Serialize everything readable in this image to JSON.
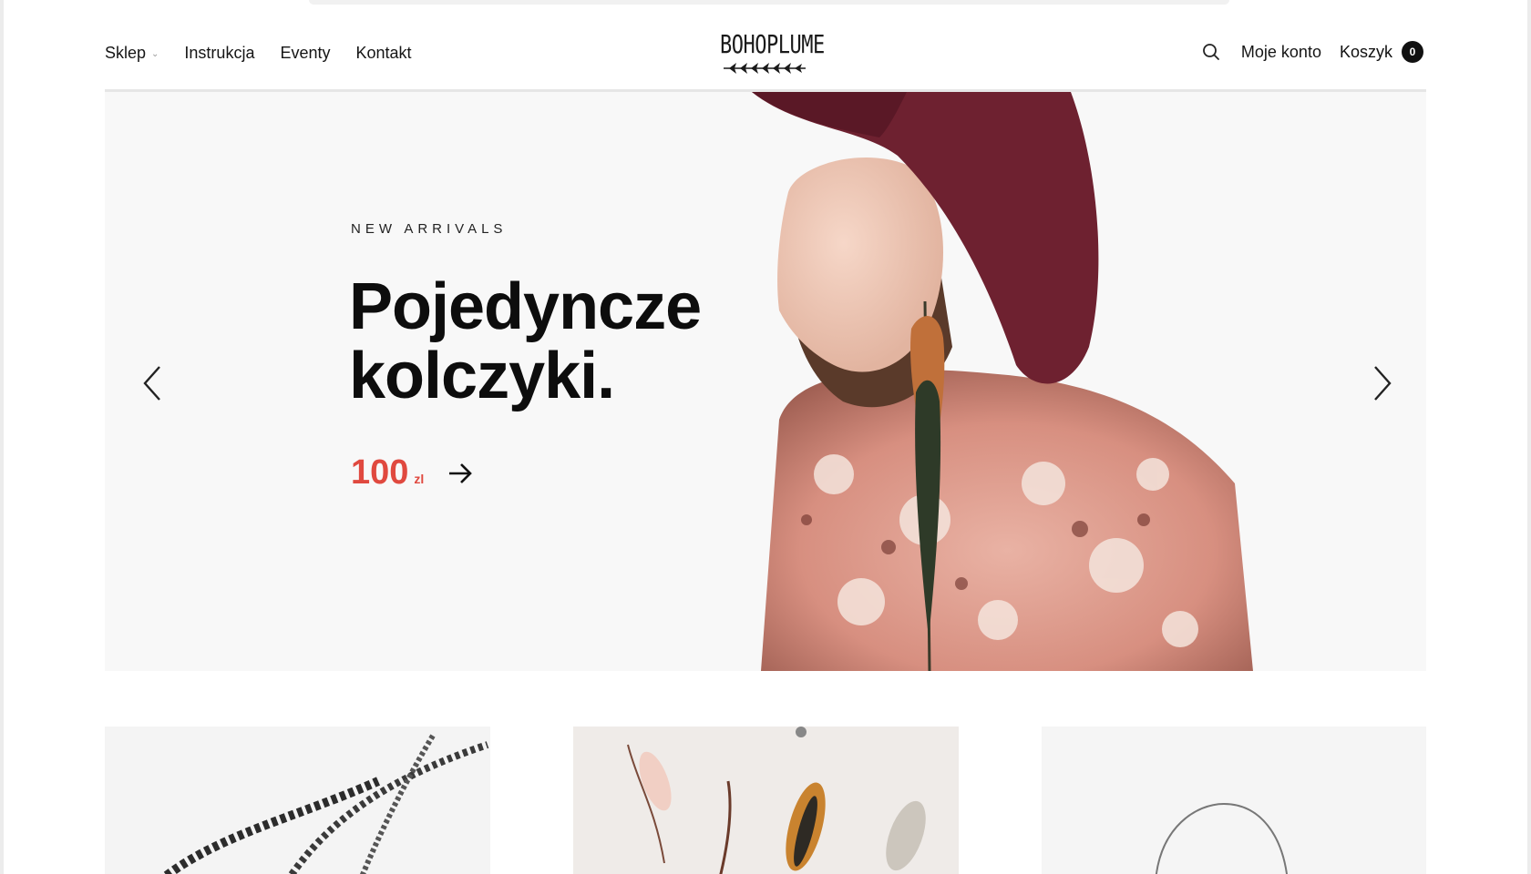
{
  "header": {
    "nav": [
      {
        "label": "Sklep",
        "has_dropdown": true
      },
      {
        "label": "Instrukcja"
      },
      {
        "label": "Eventy"
      },
      {
        "label": "Kontakt"
      }
    ],
    "logo_text": "BOHOPLUME",
    "account_label": "Moje konto",
    "cart_label": "Koszyk",
    "cart_count": "0"
  },
  "hero": {
    "eyebrow": "NEW ARRIVALS",
    "title_line1": "Pojedyncze",
    "title_line2": "kolczyki.",
    "price": "100",
    "currency": "zl"
  },
  "colors": {
    "accent": "#e0493f",
    "badge": "#111111",
    "hero_bg": "#f8f8f8"
  },
  "icons": {
    "search": "search-icon",
    "prev": "chevron-left-icon",
    "next": "chevron-right-icon",
    "cta": "arrow-right-icon"
  }
}
